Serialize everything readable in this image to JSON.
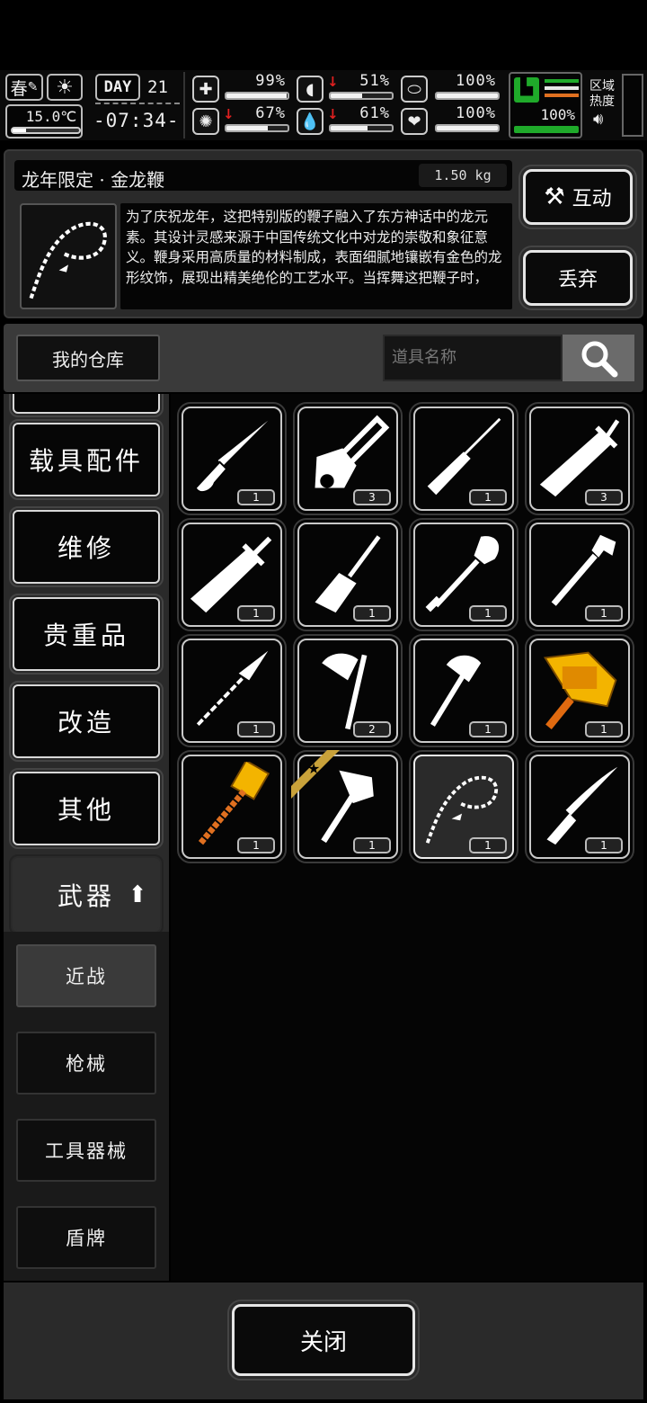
{
  "hud": {
    "season": "春",
    "day_label": "DAY",
    "day": "21",
    "temperature": "15.0℃",
    "time": "-07:34-",
    "region_label": "区域\n热度",
    "stats": [
      {
        "name": "health",
        "value": "99%",
        "level": 0.99,
        "down": false
      },
      {
        "name": "hunger",
        "value": "51%",
        "level": 0.51,
        "down": true
      },
      {
        "name": "stamina",
        "value": "100%",
        "level": 1.0,
        "down": false
      },
      {
        "name": "mental",
        "value": "67%",
        "level": 0.67,
        "down": true
      },
      {
        "name": "thirst",
        "value": "61%",
        "level": 0.61,
        "down": true
      },
      {
        "name": "mood",
        "value": "100%",
        "level": 1.0,
        "down": false
      }
    ],
    "energy": "100%"
  },
  "detail": {
    "name": "龙年限定 · 金龙鞭",
    "weight": "1.50 kg",
    "description": "为了庆祝龙年，这把特别版的鞭子融入了东方神话中的龙元素。其设计灵感来源于中国传统文化中对龙的崇敬和象征意义。鞭身采用高质量的材料制成，表面细腻地镶嵌有金色的龙形纹饰，展现出精美绝伦的工艺水平。当挥舞这把鞭子时，",
    "interact_label": "互动",
    "discard_label": "丢弃"
  },
  "storage": {
    "label": "我的仓库",
    "search_placeholder": "道具名称"
  },
  "categories": [
    "载具配件",
    "维修",
    "贵重品",
    "改造",
    "其他"
  ],
  "weapons_label": "武器",
  "subcategories": [
    "近战",
    "枪械",
    "工具器械",
    "盾牌"
  ],
  "items": [
    {
      "icon": "folding-knife-icon",
      "qty": "1"
    },
    {
      "icon": "chainsaw-icon",
      "qty": "3"
    },
    {
      "icon": "screwdriver-icon",
      "qty": "1"
    },
    {
      "icon": "broadsword-icon",
      "qty": "3"
    },
    {
      "icon": "machete-icon",
      "qty": "1"
    },
    {
      "icon": "putty-knife-icon",
      "qty": "1"
    },
    {
      "icon": "shovel-icon",
      "qty": "1"
    },
    {
      "icon": "wrench-icon",
      "qty": "1"
    },
    {
      "icon": "spear-icon",
      "qty": "1"
    },
    {
      "icon": "axe-icon",
      "qty": "2"
    },
    {
      "icon": "hatchet-icon",
      "qty": "1"
    },
    {
      "icon": "golden-chainsaw-icon",
      "qty": "1"
    },
    {
      "icon": "golden-hammer-icon",
      "qty": "1"
    },
    {
      "icon": "tactical-axe-icon",
      "qty": "1",
      "tag": true
    },
    {
      "icon": "golden-dragon-whip-icon",
      "qty": "1",
      "selected": true
    },
    {
      "icon": "hunting-knife-icon",
      "qty": "1"
    }
  ],
  "close_label": "关闭"
}
